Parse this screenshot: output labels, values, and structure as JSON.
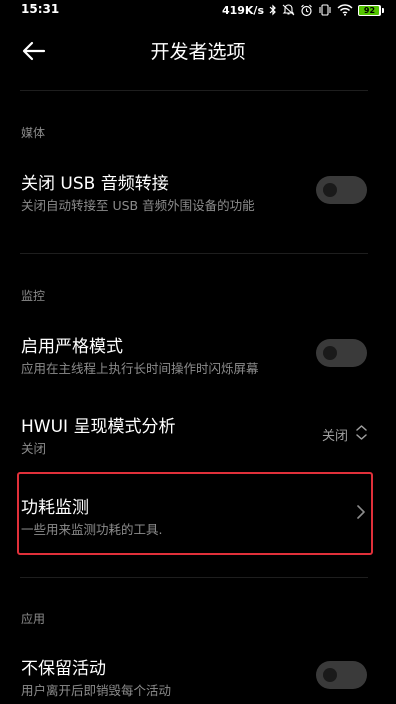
{
  "status_bar": {
    "time": "15:31",
    "net_speed": "419K/s",
    "battery_level": "92",
    "icons": [
      "bluetooth-icon",
      "mute-icon",
      "alarm-icon",
      "vibrate-icon",
      "wifi-icon",
      "battery-icon"
    ]
  },
  "header": {
    "title": "开发者选项",
    "back_icon": "back-arrow-icon"
  },
  "sections": {
    "media": {
      "label": "媒体"
    },
    "monitoring": {
      "label": "监控"
    },
    "apps": {
      "label": "应用"
    }
  },
  "rows": {
    "usb_audio": {
      "title": "关闭 USB 音频转接",
      "subtitle": "关闭自动转接至 USB 音频外围设备的功能",
      "enabled": false
    },
    "strict_mode": {
      "title": "启用严格模式",
      "subtitle": "应用在主线程上执行长时间操作时闪烁屏幕",
      "enabled": false
    },
    "hwui": {
      "title": "HWUI 呈现模式分析",
      "subtitle": "关闭",
      "value": "关闭"
    },
    "power_monitor": {
      "title": "功耗监测",
      "subtitle": "一些用来监测功耗的工具."
    },
    "dont_keep": {
      "title": "不保留活动",
      "subtitle": "用户离开后即销毁每个活动",
      "enabled": false
    }
  },
  "colors": {
    "background": "#000000",
    "highlight": "#e0303a",
    "toggle_off": "#3a3a3a",
    "battery": "#53c400"
  }
}
